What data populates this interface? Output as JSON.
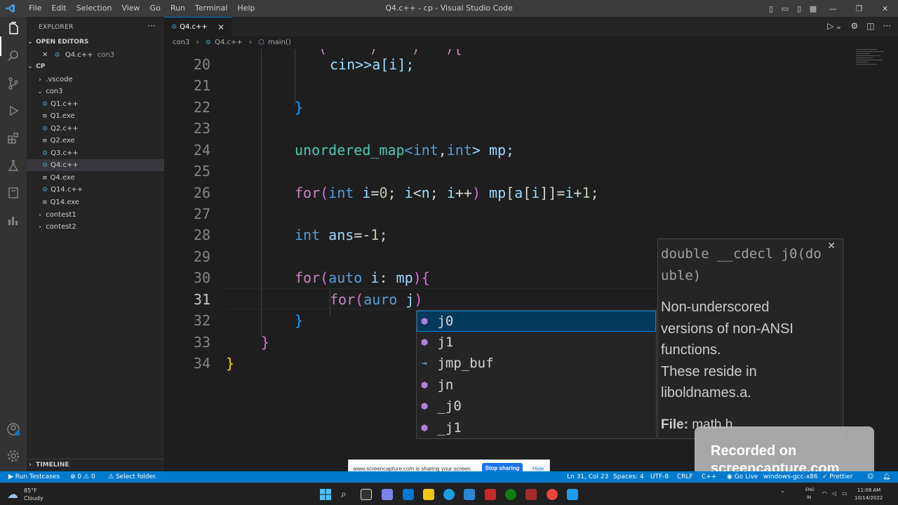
{
  "window": {
    "title": "Q4.c++ - cp - Visual Studio Code",
    "menu": [
      "File",
      "Edit",
      "Selection",
      "View",
      "Go",
      "Run",
      "Terminal",
      "Help"
    ]
  },
  "sidebar": {
    "header": "EXPLORER",
    "open_editors_label": "OPEN EDITORS",
    "open_editor": {
      "name": "Q4.c++",
      "folder": "con3"
    },
    "workspace": "CP",
    "tree": [
      {
        "label": ".vscode",
        "kind": "folder"
      },
      {
        "label": "con3",
        "kind": "folder-open"
      },
      {
        "label": "Q1.c++",
        "kind": "cpp"
      },
      {
        "label": "Q1.exe",
        "kind": "exe"
      },
      {
        "label": "Q2.c++",
        "kind": "cpp"
      },
      {
        "label": "Q2.exe",
        "kind": "exe"
      },
      {
        "label": "Q3.c++",
        "kind": "cpp"
      },
      {
        "label": "Q4.c++",
        "kind": "cpp"
      },
      {
        "label": "Q4.exe",
        "kind": "exe"
      },
      {
        "label": "Q14.c++",
        "kind": "cpp"
      },
      {
        "label": "Q14.exe",
        "kind": "exe"
      },
      {
        "label": "contest1",
        "kind": "folder"
      },
      {
        "label": "contest2",
        "kind": "folder"
      }
    ],
    "timeline_label": "TIMELINE"
  },
  "editor": {
    "tab": "Q4.c++",
    "breadcrumb": [
      "con3",
      "Q4.c++",
      "main()"
    ],
    "line_numbers": [
      "20",
      "21",
      "22",
      "23",
      "24",
      "25",
      "26",
      "27",
      "28",
      "29",
      "30",
      "31",
      "32",
      "33",
      "34"
    ],
    "lines": {
      "l20": "cin>>a[i];",
      "l24a": "unordered_map",
      "l24b": "<",
      "l24c": "int",
      "l24d": ",",
      "l24e": "int",
      "l24f": "> mp;",
      "l26": "for(int i=0; i<n; i++) mp[a[i]]=i+1;",
      "l28": "int ans=-1;",
      "l30": "for(auto i: mp){",
      "l31": "for(auro j)"
    }
  },
  "suggest": {
    "items": [
      {
        "label": "j0",
        "kind": "cube"
      },
      {
        "label": "j1",
        "kind": "cube"
      },
      {
        "label": "jmp_buf",
        "kind": "variable"
      },
      {
        "label": "jn",
        "kind": "cube"
      },
      {
        "label": "_j0",
        "kind": "cube"
      },
      {
        "label": "_j1",
        "kind": "cube"
      }
    ],
    "details": {
      "signature": "double __cdecl j0(double)",
      "doc_lines": [
        "Non-underscored",
        "versions of non-ANSI",
        "functions.",
        "These reside in",
        "liboldnames.a."
      ],
      "file_label": "File:",
      "file_name": "math.h"
    }
  },
  "status_bar": {
    "run_testcases": "Run Testcases",
    "errors": "0",
    "warnings": "0",
    "select_folder": "Select folder.",
    "position": "Ln 31, Col 23",
    "spaces": "Spaces: 4",
    "encoding": "UTF-8",
    "eol": "CRLF",
    "language": "C++",
    "go_live": "Go Live",
    "compiler": "windows-gcc-x86",
    "prettier": "Prettier"
  },
  "share_bar": {
    "message": "www.screencapture.com is sharing your screen.",
    "stop_label": "Stop sharing",
    "hide_label": "Hide"
  },
  "watermark": {
    "line1": "Recorded on",
    "line2": "screencapture.com"
  },
  "taskbar": {
    "weather_temp": "85°F",
    "weather_desc": "Cloudy",
    "lang_top": "ENG",
    "lang_bottom": "IN",
    "time": "11:08 AM",
    "date": "10/14/2022"
  },
  "colors": {
    "accent": "#007acc",
    "activity_bar": "#333333",
    "sidebar": "#252526",
    "editor": "#1e1e1e",
    "keyword": "#569cd6",
    "type": "#4ec9b0",
    "variable": "#9cdcfe",
    "number": "#b5cea8",
    "control": "#c586c0"
  }
}
